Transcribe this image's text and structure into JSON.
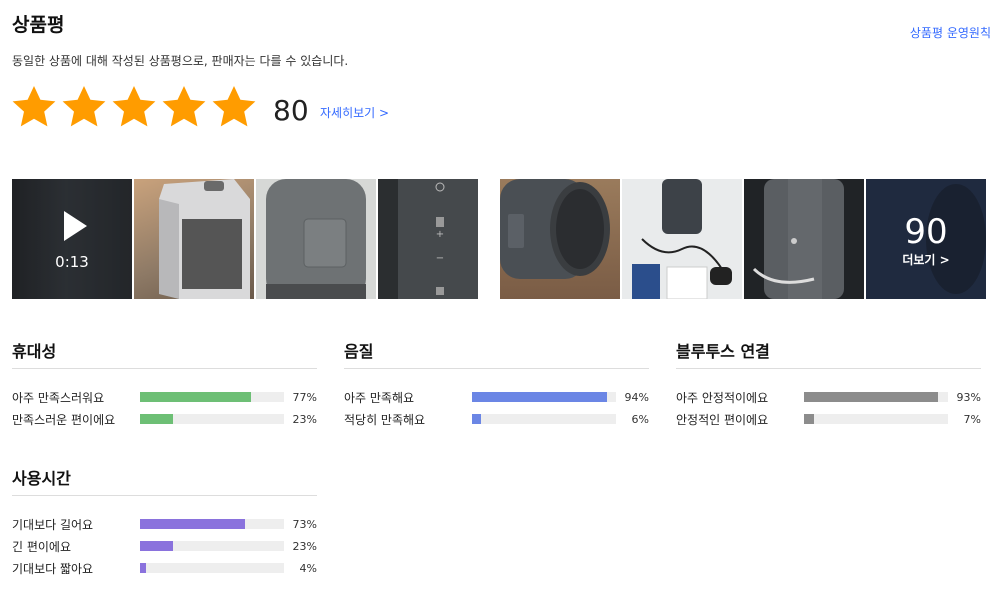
{
  "header": {
    "title": "상품평",
    "policy_link": "상품평 운영원칙",
    "description": "동일한 상품에 대해 작성된 상품평으로, 판매자는 다를 수 있습니다."
  },
  "rating": {
    "stars": 5,
    "stars_max": 5,
    "count": "80",
    "detail_link": "자세히보기 >",
    "star_color": "#ff9c00"
  },
  "photos": {
    "video_duration": "0:13",
    "more_count": "90",
    "more_label": "더보기 >",
    "items": [
      {
        "name": "video-thumb"
      },
      {
        "name": "box-photo"
      },
      {
        "name": "speaker-back-photo"
      },
      {
        "name": "speaker-buttons-photo"
      },
      {
        "name": "speaker-side-photo"
      },
      {
        "name": "unboxing-photo"
      },
      {
        "name": "speaker-closeup-photo"
      },
      {
        "name": "more-photo"
      }
    ]
  },
  "surveys": [
    {
      "title": "휴대성",
      "color": "#6dbf75",
      "rows": [
        {
          "label": "아주 만족스러워요",
          "value": 77,
          "pct": "77%"
        },
        {
          "label": "만족스러운 편이에요",
          "value": 23,
          "pct": "23%"
        }
      ]
    },
    {
      "title": "음질",
      "color": "#6b86e5",
      "rows": [
        {
          "label": "아주 만족해요",
          "value": 94,
          "pct": "94%"
        },
        {
          "label": "적당히 만족해요",
          "value": 6,
          "pct": "6%"
        }
      ]
    },
    {
      "title": "블루투스 연결",
      "color": "#8c8c8c",
      "rows": [
        {
          "label": "아주 안정적이에요",
          "value": 93,
          "pct": "93%"
        },
        {
          "label": "안정적인 편이에요",
          "value": 7,
          "pct": "7%"
        }
      ]
    },
    {
      "title": "사용시간",
      "color": "#8a72dd",
      "rows": [
        {
          "label": "기대보다 길어요",
          "value": 73,
          "pct": "73%"
        },
        {
          "label": "긴 편이에요",
          "value": 23,
          "pct": "23%"
        },
        {
          "label": "기대보다 짧아요",
          "value": 4,
          "pct": "4%"
        }
      ]
    }
  ]
}
